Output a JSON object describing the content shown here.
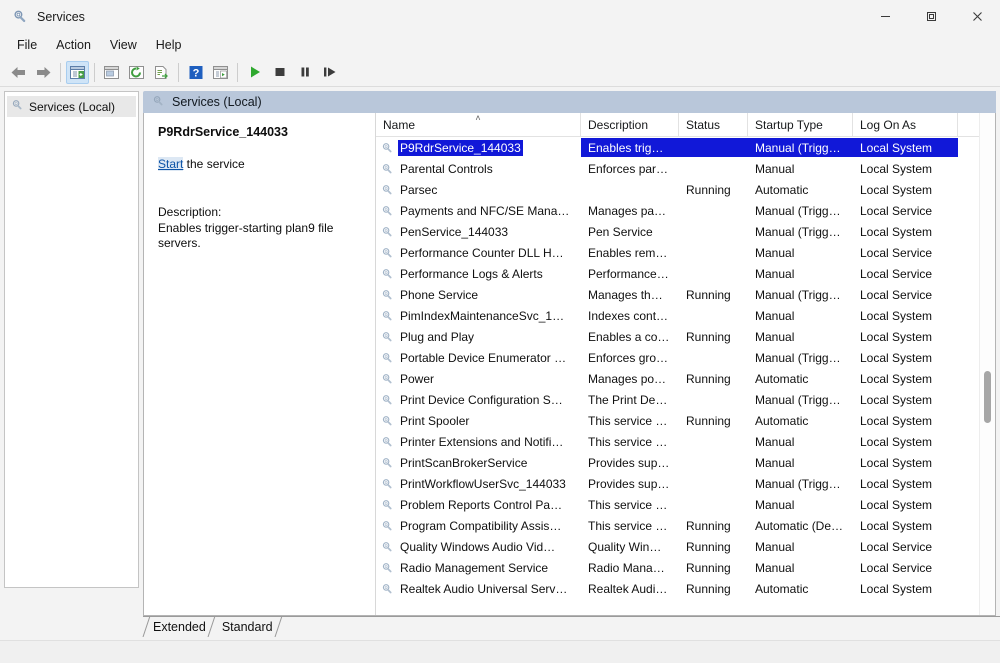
{
  "window": {
    "title": "Services",
    "app_icon": "services-gear-icon",
    "controls": {
      "minimize": "—",
      "maximize": "□",
      "close": "✕"
    }
  },
  "menu": {
    "items": [
      {
        "label": "File"
      },
      {
        "label": "Action"
      },
      {
        "label": "View"
      },
      {
        "label": "Help"
      }
    ]
  },
  "toolbar": {
    "buttons": [
      {
        "name": "back-arrow-icon",
        "glyph": "⬅"
      },
      {
        "name": "forward-arrow-icon",
        "glyph": "➡"
      },
      {
        "name": "show-hide-console-tree-icon",
        "active": true
      },
      {
        "name": "properties-icon",
        "active": false
      },
      {
        "name": "refresh-icon",
        "active": false
      },
      {
        "name": "export-list-icon",
        "active": false
      },
      {
        "name": "help-icon",
        "active": false
      },
      {
        "name": "show-action-pane-icon",
        "active": false
      },
      {
        "name": "start-service-icon",
        "active": false
      },
      {
        "name": "stop-service-icon",
        "active": false
      },
      {
        "name": "pause-service-icon",
        "active": false
      },
      {
        "name": "restart-service-icon",
        "active": false
      }
    ]
  },
  "tree": {
    "items": [
      {
        "label": "Services (Local)",
        "icon": "services-gear-icon",
        "selected": true
      }
    ]
  },
  "pane": {
    "header": "Services (Local)",
    "header_icon": "services-gear-icon"
  },
  "details": {
    "service_name": "P9RdrService_144033",
    "action_link": "Start",
    "action_suffix": " the service",
    "description_label": "Description:",
    "description_text": "Enables trigger-starting plan9 file servers."
  },
  "list": {
    "columns": [
      {
        "key": "name",
        "label": "Name",
        "sorted": "asc",
        "sort_glyph": "˄"
      },
      {
        "key": "desc",
        "label": "Description"
      },
      {
        "key": "status",
        "label": "Status"
      },
      {
        "key": "startup",
        "label": "Startup Type"
      },
      {
        "key": "logon",
        "label": "Log On As"
      }
    ],
    "rows": [
      {
        "name": "P9RdrService_144033",
        "desc": "Enables trig…",
        "status": "",
        "startup": "Manual (Trigg…",
        "logon": "Local System",
        "selected": true
      },
      {
        "name": "Parental Controls",
        "desc": "Enforces par…",
        "status": "",
        "startup": "Manual",
        "logon": "Local System",
        "selected": false
      },
      {
        "name": "Parsec",
        "desc": "",
        "status": "Running",
        "startup": "Automatic",
        "logon": "Local System",
        "selected": false
      },
      {
        "name": "Payments and NFC/SE Mana…",
        "desc": "Manages pa…",
        "status": "",
        "startup": "Manual (Trigg…",
        "logon": "Local Service",
        "selected": false
      },
      {
        "name": "PenService_144033",
        "desc": "Pen Service",
        "status": "",
        "startup": "Manual (Trigg…",
        "logon": "Local System",
        "selected": false
      },
      {
        "name": "Performance Counter DLL H…",
        "desc": "Enables rem…",
        "status": "",
        "startup": "Manual",
        "logon": "Local Service",
        "selected": false
      },
      {
        "name": "Performance Logs & Alerts",
        "desc": "Performance…",
        "status": "",
        "startup": "Manual",
        "logon": "Local Service",
        "selected": false
      },
      {
        "name": "Phone Service",
        "desc": "Manages th…",
        "status": "Running",
        "startup": "Manual (Trigg…",
        "logon": "Local Service",
        "selected": false
      },
      {
        "name": "PimIndexMaintenanceSvc_1…",
        "desc": "Indexes cont…",
        "status": "",
        "startup": "Manual",
        "logon": "Local System",
        "selected": false
      },
      {
        "name": "Plug and Play",
        "desc": "Enables a co…",
        "status": "Running",
        "startup": "Manual",
        "logon": "Local System",
        "selected": false
      },
      {
        "name": "Portable Device Enumerator …",
        "desc": "Enforces gro…",
        "status": "",
        "startup": "Manual (Trigg…",
        "logon": "Local System",
        "selected": false
      },
      {
        "name": "Power",
        "desc": "Manages po…",
        "status": "Running",
        "startup": "Automatic",
        "logon": "Local System",
        "selected": false
      },
      {
        "name": "Print Device Configuration S…",
        "desc": "The Print De…",
        "status": "",
        "startup": "Manual (Trigg…",
        "logon": "Local System",
        "selected": false
      },
      {
        "name": "Print Spooler",
        "desc": "This service …",
        "status": "Running",
        "startup": "Automatic",
        "logon": "Local System",
        "selected": false
      },
      {
        "name": "Printer Extensions and Notifi…",
        "desc": "This service …",
        "status": "",
        "startup": "Manual",
        "logon": "Local System",
        "selected": false
      },
      {
        "name": "PrintScanBrokerService",
        "desc": "Provides sup…",
        "status": "",
        "startup": "Manual",
        "logon": "Local System",
        "selected": false
      },
      {
        "name": "PrintWorkflowUserSvc_144033",
        "desc": "Provides sup…",
        "status": "",
        "startup": "Manual (Trigg…",
        "logon": "Local System",
        "selected": false
      },
      {
        "name": "Problem Reports Control Pa…",
        "desc": "This service …",
        "status": "",
        "startup": "Manual",
        "logon": "Local System",
        "selected": false
      },
      {
        "name": "Program Compatibility Assis…",
        "desc": "This service …",
        "status": "Running",
        "startup": "Automatic (De…",
        "logon": "Local System",
        "selected": false
      },
      {
        "name": "Quality Windows Audio Vid…",
        "desc": "Quality Win…",
        "status": "Running",
        "startup": "Manual",
        "logon": "Local Service",
        "selected": false
      },
      {
        "name": "Radio Management Service",
        "desc": "Radio Mana…",
        "status": "Running",
        "startup": "Manual",
        "logon": "Local Service",
        "selected": false
      },
      {
        "name": "Realtek Audio Universal Serv…",
        "desc": "Realtek Audi…",
        "status": "Running",
        "startup": "Automatic",
        "logon": "Local System",
        "selected": false
      }
    ]
  },
  "tabs": [
    {
      "label": "Extended",
      "active": true
    },
    {
      "label": "Standard",
      "active": false
    }
  ],
  "colors": {
    "selection_blue": "#1118d8",
    "pane_header": "#b9c7da",
    "link": "#0d53a6",
    "start_green": "#2ea82e"
  }
}
